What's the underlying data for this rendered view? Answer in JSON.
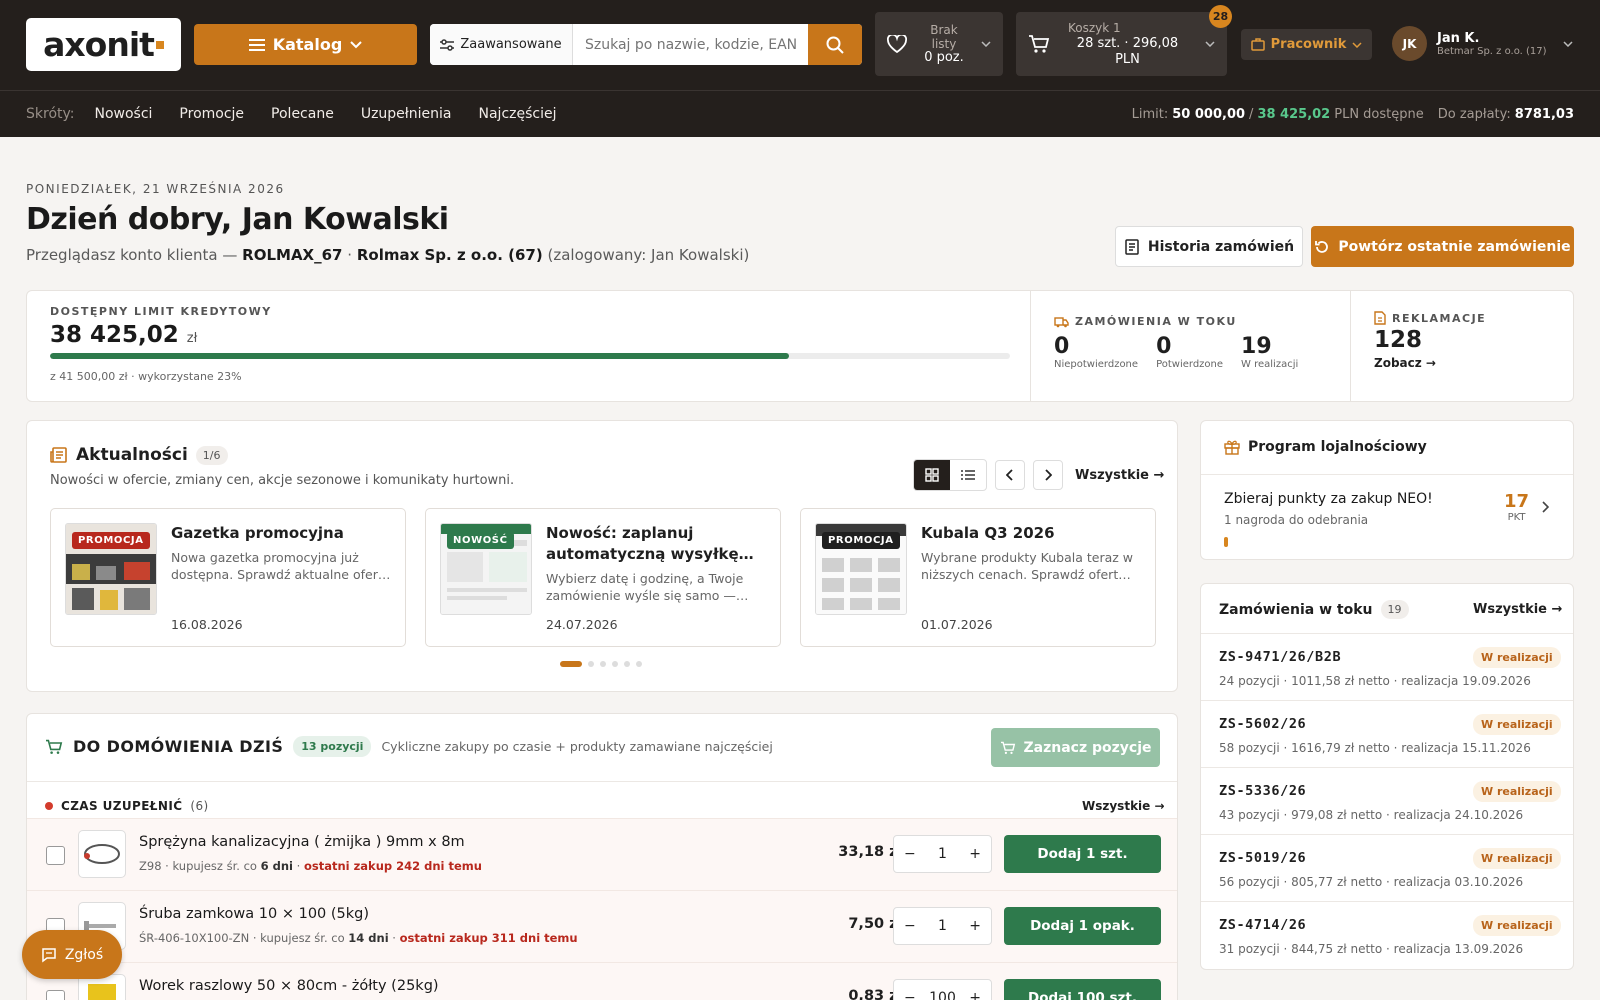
{
  "header": {
    "logo": "axonit",
    "katalog": "Katalog",
    "advanced": "Zaawansowane",
    "search_placeholder": "Szukaj po nazwie, kodzie, EAN",
    "wishlist_line1": "Brak",
    "wishlist_line2": "listy",
    "wishlist_line3": "0 poz.",
    "cart_title": "Koszyk 1",
    "cart_line1": "28 szt. · 296,08",
    "cart_line2": "PLN",
    "cart_badge": "28",
    "employee": "Pracownik",
    "user_initials": "JK",
    "user_name": "Jan K.",
    "user_company": "Betmar Sp. z o.o. (17)"
  },
  "subbar": {
    "label": "Skróty:",
    "links": [
      "Nowości",
      "Promocje",
      "Polecane",
      "Uzupełnienia",
      "Najczęściej"
    ],
    "limit_label": "Limit:",
    "limit_value": "50 000,00",
    "sep": "/",
    "available_value": "38 425,02",
    "available_label": "PLN dostępne",
    "to_pay_label": "Do zapłaty:",
    "to_pay_value": "8781,03"
  },
  "welcome": {
    "date": "PONIEDZIAŁEK, 21 WRZEŚNIA 2026",
    "greeting": "Dzień dobry, Jan Kowalski",
    "sub_prefix": "Przeglądasz konto klienta —",
    "account_code": "ROLMAX_67",
    "dot": "·",
    "account_name": "Rolmax Sp. z o.o. (67)",
    "logged": "(zalogowany: Jan Kowalski)",
    "history_btn": "Historia zamówień",
    "repeat_btn": "Powtórz ostatnie zamówienie"
  },
  "stats": {
    "credit_label": "DOSTĘPNY LIMIT KREDYTOWY",
    "credit_amount": "38 425,02",
    "credit_unit": "zł",
    "credit_progress": 0.77,
    "credit_note": "z 41 500,00 zł · wykorzystane 23%",
    "orders_label": "ZAMÓWIENIA W TOKU",
    "orders": [
      {
        "num": "0",
        "cap": "Niepotwierdzone"
      },
      {
        "num": "0",
        "cap": "Potwierdzone"
      },
      {
        "num": "19",
        "cap": "W realizacji"
      }
    ],
    "complaints_label": "REKLAMACJE",
    "complaints_count": "128",
    "complaints_link": "Zobacz →"
  },
  "news": {
    "title": "Aktualności",
    "count": "1/6",
    "desc": "Nowości w ofercie, zmiany cen, akcje sezonowe i komunikaty hurtowni.",
    "all": "Wszystkie →",
    "cards": [
      {
        "tag": "PROMOCJA",
        "tag_color": "#b8281d",
        "title": "Gazetka promocyjna",
        "desc": "Nowa gazetka promocyjna już dostępna. Sprawdź aktualne ofer…",
        "date": "16.08.2026"
      },
      {
        "tag": "NOWOŚĆ",
        "tag_color": "#2e7a4c",
        "title": "Nowość: zaplanuj automatyczną wysyłkę…",
        "desc": "Wybierz datę i godzinę, a Twoje zamówienie wyśle się samo —…",
        "date": "24.07.2026"
      },
      {
        "tag": "PROMOCJA",
        "tag_color": "#1f1f1f",
        "title": "Kubala Q3 2026",
        "desc": "Wybrane produkty Kubala teraz w niższych cenach. Sprawdź ofert…",
        "date": "01.07.2026"
      }
    ]
  },
  "reorder": {
    "title": "DO DOMÓWIENIA DZIŚ",
    "badge": "13 pozycji",
    "subtitle": "Cykliczne zakupy po czasie + produkty zamawiane najczęściej",
    "mark_btn": "Zaznacz pozycje",
    "cat_label": "CZAS UZUPEŁNIĆ",
    "cat_count": "(6)",
    "cat_all": "Wszystkie →",
    "products": [
      {
        "name": "Sprężyna kanalizacyjna ( żmijka ) 9mm x 8m",
        "code": "Z98",
        "every_label": "· kupujesz śr. co",
        "every": "6 dni",
        "last": "ostatni zakup 242 dni temu",
        "price": "33,18 zł",
        "qty": "1",
        "add": "Dodaj 1 szt."
      },
      {
        "name": "Śruba zamkowa 10 × 100 (5kg)",
        "code": "ŚR-406-10X100-ZN",
        "every_label": "· kupujesz śr. co",
        "every": "14 dni",
        "last": "ostatni zakup 311 dni temu",
        "price": "7,50 zł",
        "qty": "1",
        "add": "Dodaj 1 opak."
      },
      {
        "name": "Worek raszlowy 50 × 80cm - żółty (25kg)",
        "code": "",
        "every_label": "",
        "every": "",
        "last": "",
        "price": "0,83 zł",
        "qty": "100",
        "add": "Dodaj 100 szt."
      }
    ]
  },
  "loyalty": {
    "title": "Program lojalnościowy",
    "line1": "Zbieraj punkty za zakup NEO!",
    "line2": "1 nagroda do odebrania",
    "points": "17",
    "points_label": "PKT"
  },
  "orders_panel": {
    "title": "Zamówienia w toku",
    "count": "19",
    "all": "Wszystkie →",
    "items": [
      {
        "code": "ZS-9471/26/B2B",
        "status": "W realizacji",
        "meta": "24 pozycji · 1011,58 zł netto · realizacja 19.09.2026"
      },
      {
        "code": "ZS-5602/26",
        "status": "W realizacji",
        "meta": "58 pozycji · 1616,79 zł netto · realizacja 15.11.2026"
      },
      {
        "code": "ZS-5336/26",
        "status": "W realizacji",
        "meta": "43 pozycji · 979,08 zł netto · realizacja 24.10.2026"
      },
      {
        "code": "ZS-5019/26",
        "status": "W realizacji",
        "meta": "56 pozycji · 805,77 zł netto · realizacja 03.10.2026"
      },
      {
        "code": "ZS-4714/26",
        "status": "W realizacji",
        "meta": "31 pozycji · 844,75 zł netto · realizacja 13.09.2026"
      }
    ]
  },
  "report_btn": "Zgłoś",
  "colors": {
    "accent": "#c8761a",
    "dark": "#241f1c",
    "green": "#2e7a4c",
    "red": "#b8281d"
  }
}
